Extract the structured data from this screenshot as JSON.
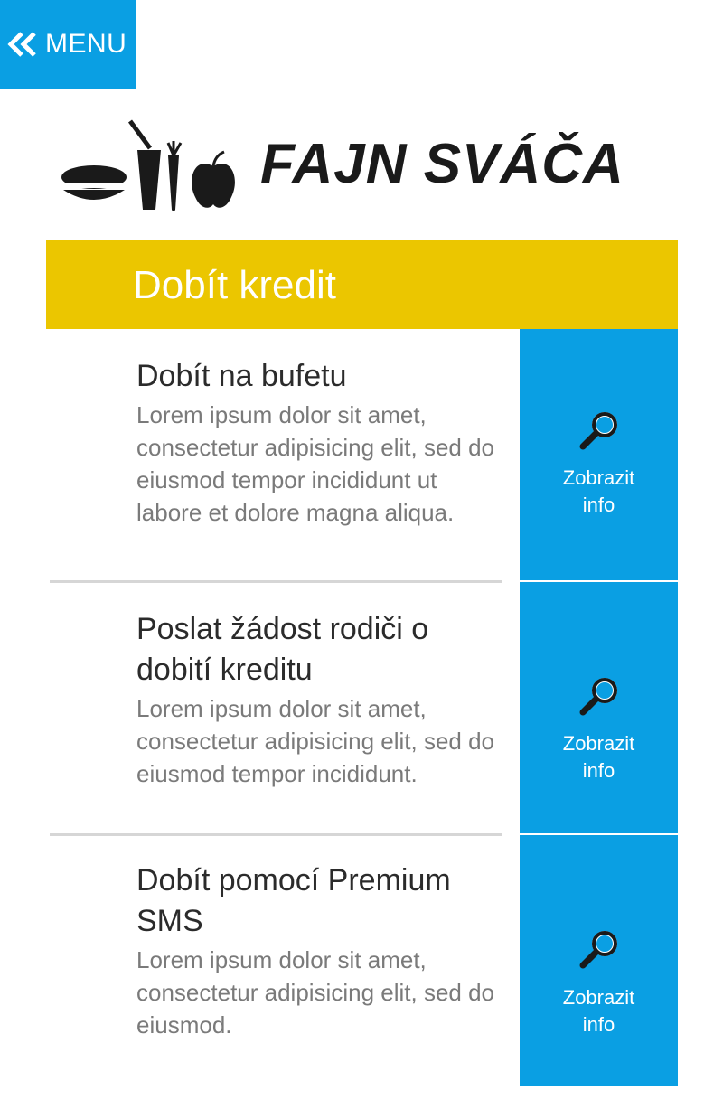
{
  "header": {
    "menu_label": "MENU"
  },
  "logo": {
    "brand": "FAJN SVÁČA"
  },
  "section": {
    "title": "Dobít kredit"
  },
  "options": [
    {
      "title": "Dobít na bufetu",
      "description": "Lorem ipsum dolor sit amet, consectetur adipisicing elit, sed do eiusmod tempor incididunt ut labore et dolore magna aliqua.",
      "action_line1": "Zobrazit",
      "action_line2": "info",
      "action_icon": "magnifier-icon"
    },
    {
      "title": "Poslat žádost rodiči o dobití kreditu",
      "description": "Lorem ipsum dolor sit amet, consectetur adipisicing elit, sed do eiusmod tempor incididunt.",
      "action_line1": "Zobrazit",
      "action_line2": "info",
      "action_icon": "magnifier-icon"
    },
    {
      "title": "Dobít pomocí Premium SMS",
      "description": "Lorem ipsum dolor sit amet, consectetur adipisicing elit, sed do eiusmod.",
      "action_line1": "Zobrazit",
      "action_line2": "info",
      "action_icon": "magnifier-icon"
    }
  ],
  "colors": {
    "accent_blue": "#0a9fe3",
    "section_yellow": "#ebc600",
    "heading_text": "#2b2b2b",
    "body_text": "#7a7a7a"
  }
}
